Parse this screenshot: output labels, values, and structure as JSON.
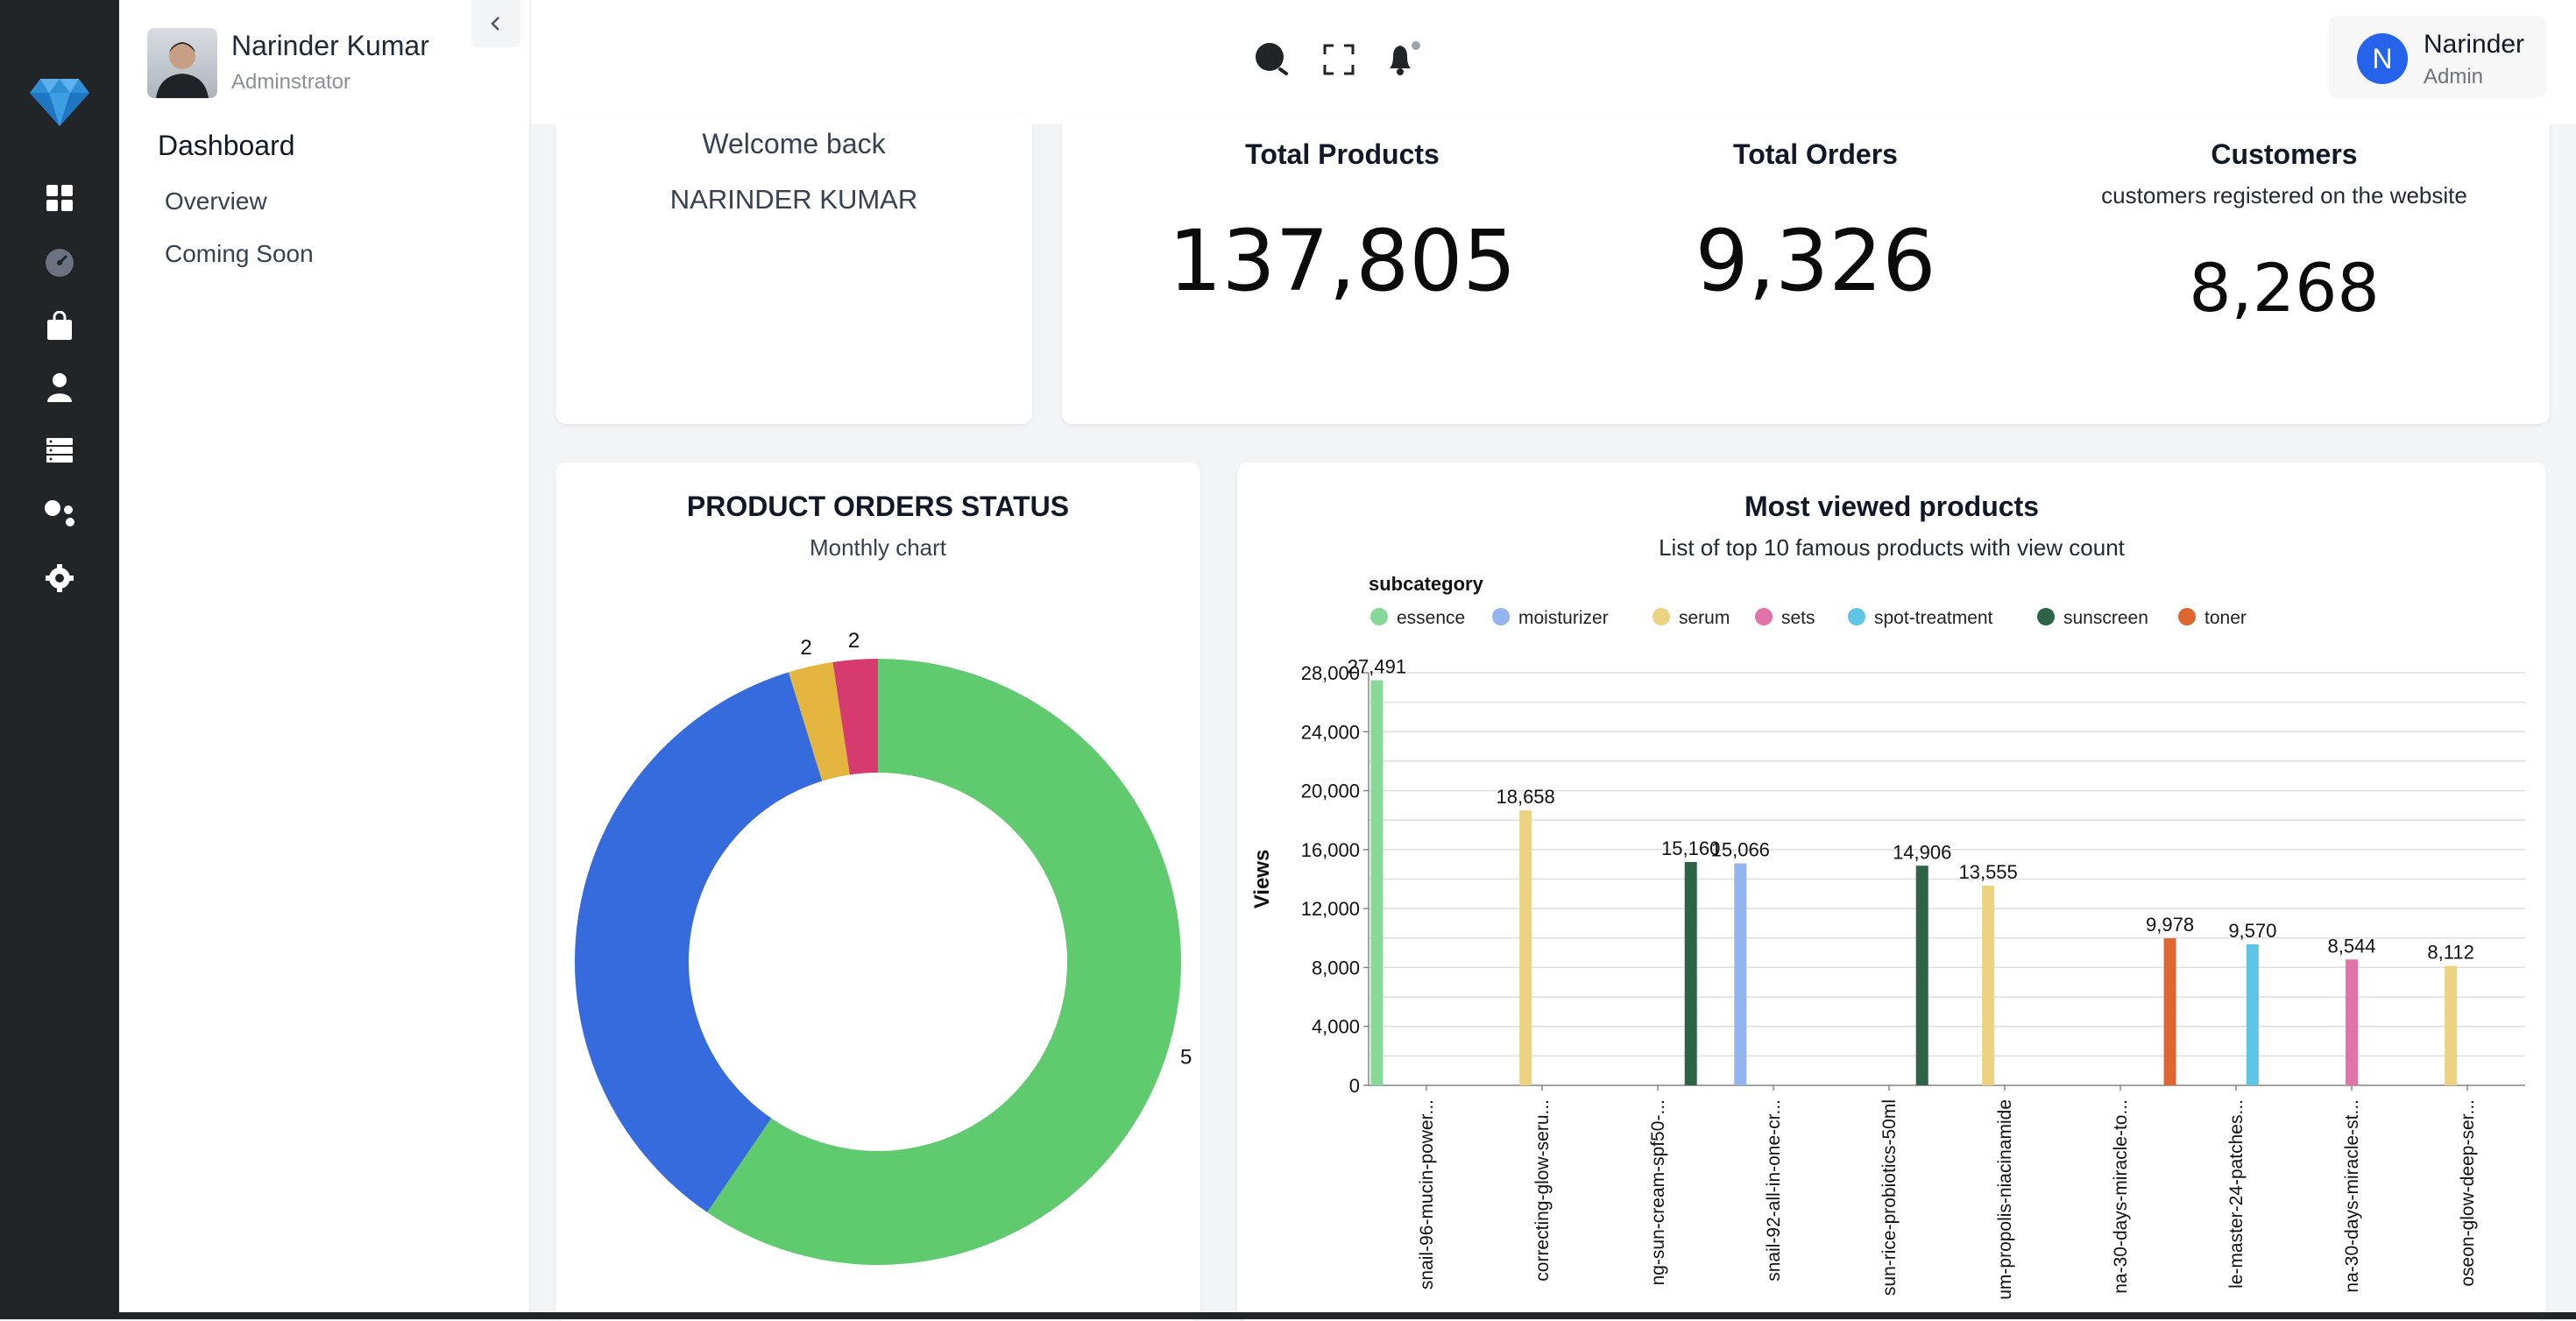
{
  "sidebar": {
    "user_name": "Narinder Kumar",
    "user_role": "Adminstrator",
    "section_title": "Dashboard",
    "items": [
      {
        "label": "Overview"
      },
      {
        "label": "Coming Soon"
      }
    ]
  },
  "rail_icons": [
    "diamond-logo-icon",
    "dashboard-grid-icon",
    "gauge-icon",
    "shopping-bag-icon",
    "user-icon",
    "server-list-icon",
    "people-group-icon",
    "settings-gear-icon"
  ],
  "topbar": {
    "icons": [
      "search-icon",
      "fullscreen-icon",
      "bell-icon"
    ],
    "user": {
      "initial": "N",
      "name": "Narinder",
      "role": "Admin"
    }
  },
  "welcome": {
    "line1": "Welcome back",
    "line2": "NARINDER KUMAR"
  },
  "stats": {
    "total_products": {
      "title": "Total Products",
      "value": "137,805"
    },
    "total_orders": {
      "title": "Total Orders",
      "value": "9,326"
    },
    "customers": {
      "title": "Customers",
      "subtitle": "customers registered on the website",
      "value": "8,268"
    }
  },
  "colors": {
    "accent": "#2563eb",
    "rail": "#212528"
  },
  "chart_data": [
    {
      "type": "pie",
      "title": "PRODUCT ORDERS STATUS",
      "subtitle": "Monthly chart",
      "donut": true,
      "slices": [
        {
          "value": 5,
          "label": "5",
          "color": "#5fca6e"
        },
        {
          "value": 3,
          "label": "",
          "color": "#356bdc"
        },
        {
          "value": 0.2,
          "label": "2",
          "color": "#e4b53f"
        },
        {
          "value": 0.2,
          "label": "2",
          "color": "#d63a6e"
        }
      ]
    },
    {
      "type": "bar",
      "title": "Most viewed products",
      "subtitle": "List of top 10 famous products with view count",
      "legend_title": "subcategory",
      "legend": [
        {
          "name": "essence",
          "color": "#86d996"
        },
        {
          "name": "moisturizer",
          "color": "#93b4ee"
        },
        {
          "name": "serum",
          "color": "#ebd382"
        },
        {
          "name": "sets",
          "color": "#e273a9"
        },
        {
          "name": "spot-treatment",
          "color": "#5ec6e4"
        },
        {
          "name": "sunscreen",
          "color": "#2d6448"
        },
        {
          "name": "toner",
          "color": "#de6630"
        }
      ],
      "ylabel": "Views",
      "ylim": [
        0,
        28000
      ],
      "yticks": [
        "28,000",
        "24,000",
        "20,000",
        "16,000",
        "12,000",
        "8,000",
        "4,000",
        "0"
      ],
      "categories": [
        "snail-96-mucin-power...",
        "correcting-glow-seru...",
        "ng-sun-cream-spf50-...",
        "snail-92-all-in-one-cr...",
        "sun-rice-probiotics-50ml",
        "um-propolis-niacinamide",
        "na-30-days-miracle-to...",
        "le-master-24-patches...",
        "na-30-days-miracle-st...",
        "oseon-glow-deep-ser..."
      ],
      "values": [
        27491,
        18658,
        15160,
        15066,
        14906,
        13555,
        9978,
        9570,
        8544,
        8112
      ],
      "value_labels": [
        "27,491",
        "18,658",
        "15,160",
        "15,066",
        "14,906",
        "13,555",
        "9,978",
        "9,570",
        "8,544",
        "8,112"
      ],
      "subcategories": [
        "essence",
        "serum",
        "sunscreen",
        "moisturizer",
        "sunscreen",
        "serum",
        "toner",
        "spot-treatment",
        "sets",
        "serum"
      ]
    }
  ]
}
